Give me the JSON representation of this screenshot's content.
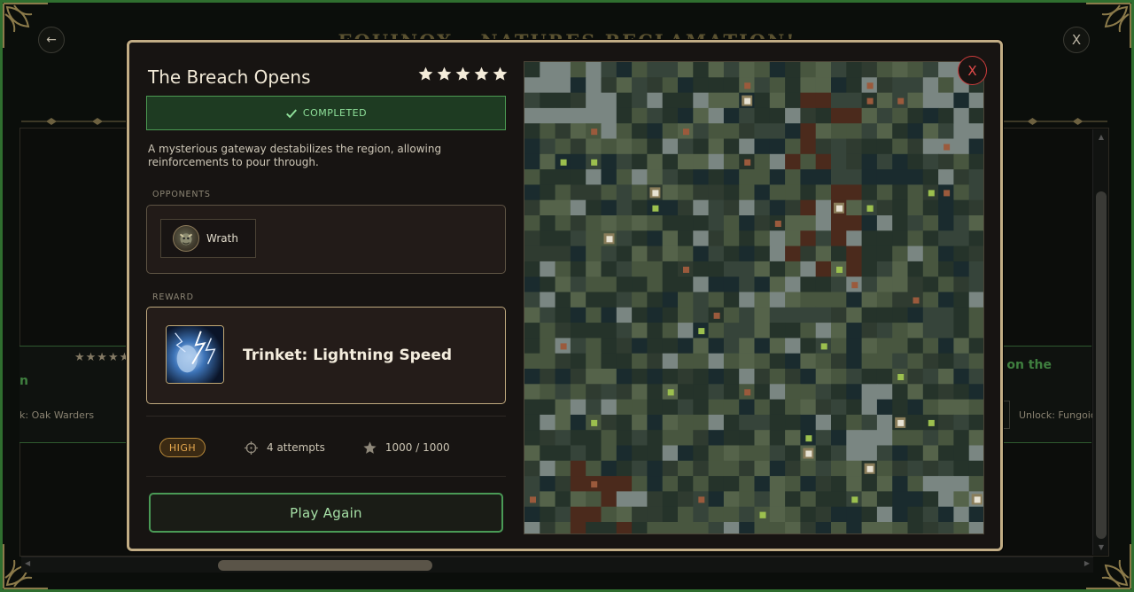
{
  "background": {
    "title": "EQUINOX – NATURES RECLAMATION!",
    "back_label": "←",
    "exit_label": "X",
    "left_card": {
      "stars": "★★★★★",
      "title_fragment": "n",
      "unlock": "k: Oak Warders"
    },
    "right_card": {
      "title_fragment": "ssi on the\nch",
      "unlock": "Unlock: Fungoid"
    }
  },
  "level": {
    "title": "The Breach Opens",
    "stars": 5,
    "stars_max": 5,
    "status": "COMPLETED",
    "description": "A mysterious gateway destabilizes the region, allowing reinforcements to pour through.",
    "opponents_label": "OPPONENTS",
    "opponents": [
      {
        "name": "Wrath",
        "icon": "wrath-avatar"
      }
    ],
    "reward_label": "REWARD",
    "reward": {
      "name": "Trinket: Lightning Speed",
      "icon": "lightning-speed-icon"
    },
    "difficulty": "HIGH",
    "attempts": "4 attempts",
    "score": "1000 / 1000",
    "play_label": "Play Again",
    "close_label": "X"
  },
  "colors": {
    "accent_gold": "#c2ad85",
    "completed_green": "#1e3b22",
    "difficulty_high": "#e6a84e",
    "close_red": "#cc3b3b",
    "map_walls": "#25332a",
    "map_grass": "#48563f",
    "map_rock": "#7a8682",
    "map_dirt": "#4b2a1c",
    "map_water": "#1a2b2e"
  }
}
